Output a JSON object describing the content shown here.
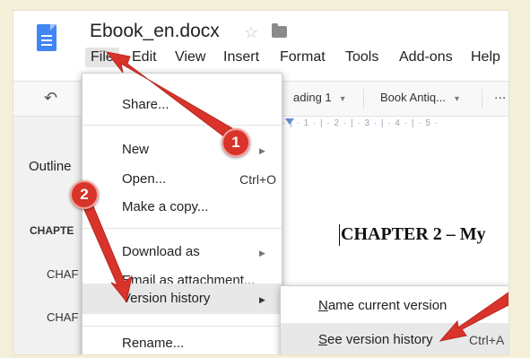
{
  "doc": {
    "title": "Ebook_en.docx",
    "icons": [
      "docs-icon",
      "star-icon",
      "folder-icon"
    ]
  },
  "menubar": [
    "File",
    "Edit",
    "View",
    "Insert",
    "Format",
    "Tools",
    "Add-ons",
    "Help"
  ],
  "toolbar": {
    "style": "ading 1",
    "font": "Book Antiq...",
    "more": "...",
    "ruler": "· | · 1 · | · 2 · | · 3 · | · 4 · | · 5 ·"
  },
  "left_pane": {
    "outline": "Outline",
    "items": [
      "CHAPTE",
      "CHAF",
      "CHAF"
    ]
  },
  "file_menu": {
    "share": "Share...",
    "new": "New",
    "open": "Open...",
    "open_shortcut": "Ctrl+O",
    "make_copy": "Make a copy...",
    "download_as": "Download as",
    "email_attachment": "Email as attachment...",
    "version_history": "Version history",
    "rename": "Rename...",
    "submenu_arrow": "▶"
  },
  "submenu": {
    "name_current": "Name current version",
    "see_history": "See version history",
    "see_history_shortcut": "Ctrl+A"
  },
  "document": {
    "heading": "CHAPTER 2 – My"
  },
  "callouts": [
    {
      "label": "1",
      "color": "#d8342b"
    },
    {
      "label": "2",
      "color": "#d8342b"
    }
  ]
}
